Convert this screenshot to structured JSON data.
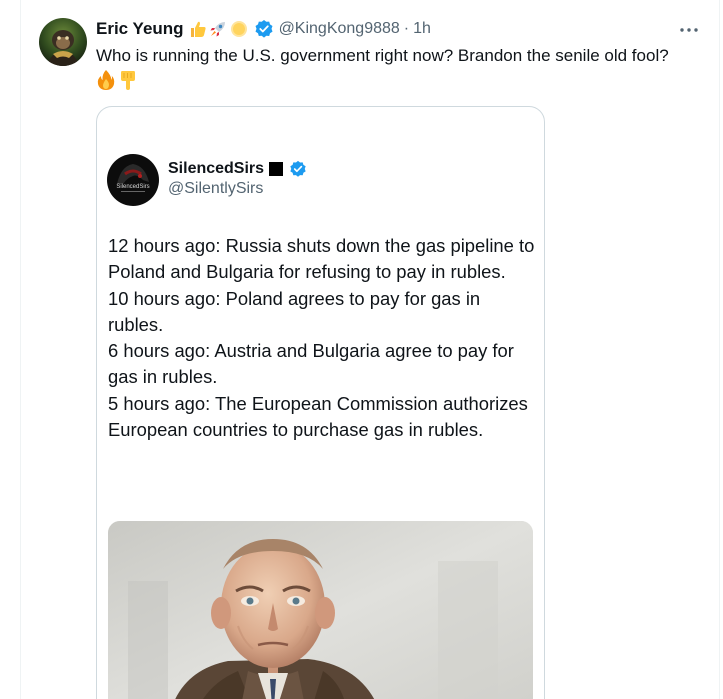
{
  "tweet": {
    "author_name": "Eric Yeung",
    "handle": "@KingKong9888",
    "separator": "·",
    "time": "1h",
    "text": "Who is running the U.S. government right now? Brandon the senile old fool?",
    "name_emojis": [
      "thumbs-up-icon",
      "rocket-icon",
      "sun-icon"
    ],
    "trailing_emojis": [
      "fire-icon",
      "pointing-down-icon"
    ],
    "verified_color": "#1d9bf0"
  },
  "quote": {
    "author_name": "SilencedSirs",
    "handle": "@SilentlySirs",
    "avatar_text": "SilencedSirs",
    "lines": [
      "12 hours ago: Russia shuts down the gas pipeline to Poland and Bulgaria for refusing to pay in rubles.",
      "10 hours ago: Poland agrees to pay for gas in rubles.",
      "6 hours ago: Austria and Bulgaria agree to pay for gas in rubles.",
      "5 hours ago: The European Commission authorizes European countries to purchase gas in rubles."
    ]
  }
}
